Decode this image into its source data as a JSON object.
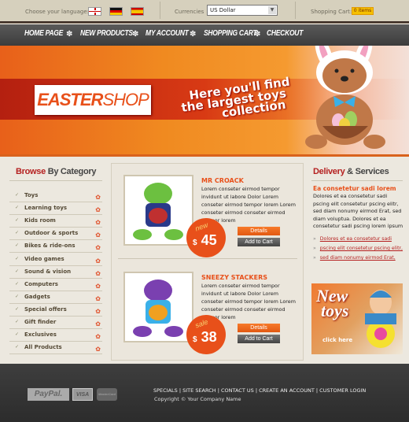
{
  "topbar": {
    "language_label": "Choose your language:",
    "languages": [
      "English",
      "Deutsch",
      "Español"
    ],
    "currency_label": "Currencies",
    "currency_value": "US Dollar",
    "cart_label": "Shopping Cart:",
    "cart_count": "0 items"
  },
  "nav": [
    "HOME PAGE",
    "NEW PRODUCTS",
    "MY ACCOUNT",
    "SHOPPING CART",
    "CHECKOUT"
  ],
  "banner": {
    "logo_bold": "EASTER",
    "logo_light": "SHOP",
    "tagline_1": "Here you'll find",
    "tagline_2": "the largest toys",
    "tagline_3": "collection"
  },
  "categories": {
    "title_accent": "Browse",
    "title_rest": " By Category",
    "items": [
      "Toys",
      "Learning toys",
      "Kids room",
      "Outdoor & sports",
      "Bikes & ride-ons",
      "Video games",
      "Sound & vision",
      "Computers",
      "Gadgets",
      "Special offers",
      "Gift finder",
      "Exclusives",
      "All Products"
    ]
  },
  "products": [
    {
      "name": "MR CROACK",
      "description": "Lorem conseter eirmod tempor invidunt ut labore Dolor Lorem conseter eirmod tempor lorem Lorem conseter eirmod conseter eirmod tempor lorem",
      "badge": "new",
      "currency": "$",
      "price": "45",
      "details": "Details",
      "add_to_cart": "Add to Cart"
    },
    {
      "name": "SNEEZY STACKERS",
      "description": "Lorem conseter eirmod tempor invidunt ut labore Dolor Lorem conseter eirmod tempor lorem Lorem conseter eirmod conseter eirmod tempor lorem",
      "badge": "sale",
      "currency": "$",
      "price": "38",
      "details": "Details",
      "add_to_cart": "Add to Cart"
    }
  ],
  "delivery": {
    "title_accent": "Delivery",
    "title_rest": " & Services",
    "heading": "Ea consetetur sadi lorem",
    "text": "Dolores et ea consetetur sadi pscing elit consetetur pscing elitr, sed diam nonumy eirmod Erat, sed diam voluptua. Dolores et ea consetetur sadi pscing lorem ipsum",
    "links": [
      "Dolores et ea consetetur sadi",
      "pscing elit consetetur pscing elitr,",
      "sed diam nonumy eirmod Erat,"
    ]
  },
  "promo": {
    "line1": "New",
    "line2": "toys",
    "cta": "click here"
  },
  "footer": {
    "payments": [
      "PayPal",
      "VISA",
      "MasterCard"
    ],
    "links": [
      "SPECIALS",
      "SITE SEARCH",
      "CONTACT US",
      "CREATE AN ACCOUNT",
      "CUSTOMER LOGIN"
    ],
    "separator": " | ",
    "copyright": "Copyright © Your Company Name"
  },
  "colors": {
    "accent": "#e8501a",
    "title_red": "#b52020",
    "nav_bg": "#4a4a4a",
    "footer_bg": "#333333"
  }
}
